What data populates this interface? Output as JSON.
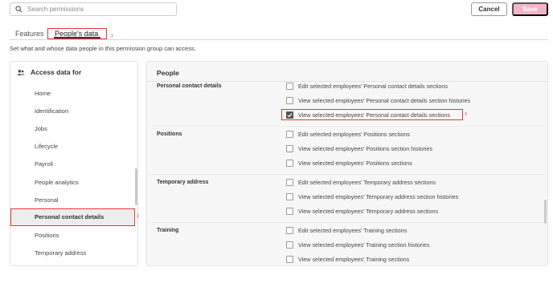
{
  "search": {
    "placeholder": "Search permissions"
  },
  "toolbar": {
    "cancel_label": "Cancel",
    "save_label": "Save"
  },
  "tabs": [
    {
      "label": "Features"
    },
    {
      "label": "People's data"
    }
  ],
  "markers": [
    "1",
    "2",
    "3"
  ],
  "description": "Set what and whose data people in this permission group can access.",
  "left_panel": {
    "title": "Access data for",
    "items": [
      {
        "label": "Home"
      },
      {
        "label": "Identification"
      },
      {
        "label": "Jobs"
      },
      {
        "label": "Lifecycle"
      },
      {
        "label": "Payroll"
      },
      {
        "label": "People analytics"
      },
      {
        "label": "Personal"
      },
      {
        "label": "Personal contact details"
      },
      {
        "label": "Positions"
      },
      {
        "label": "Temporary address"
      }
    ],
    "selected": "Personal contact details"
  },
  "right_panel": {
    "title": "People",
    "groups": [
      {
        "title": "Personal contact details",
        "perms": [
          {
            "label": "Edit selected employees' Personal contact details sections",
            "checked": false
          },
          {
            "label": "View selected employees' Personal contact details section histories",
            "checked": false
          },
          {
            "label": "View selected employees' Personal contact details sections",
            "checked": true
          }
        ]
      },
      {
        "title": "Positions",
        "perms": [
          {
            "label": "Edit selected employees' Positions sections",
            "checked": false
          },
          {
            "label": "View selected employees' Positions section histories",
            "checked": false
          },
          {
            "label": "View selected employees' Positions sections",
            "checked": false
          }
        ]
      },
      {
        "title": "Temporary address",
        "perms": [
          {
            "label": "Edit selected employees' Temporary address sections",
            "checked": false
          },
          {
            "label": "View selected employees' Temporary address section histories",
            "checked": false
          },
          {
            "label": "View selected employees' Temporary address sections",
            "checked": false
          }
        ]
      },
      {
        "title": "Training",
        "perms": [
          {
            "label": "Edit selected employees' Training sections",
            "checked": false
          },
          {
            "label": "View selected employees' Training section histories",
            "checked": false
          },
          {
            "label": "View selected employees' Training sections",
            "checked": false
          }
        ]
      }
    ]
  },
  "colors": {
    "accent": "#e03a3a",
    "save_button": "#f2b4c9"
  }
}
